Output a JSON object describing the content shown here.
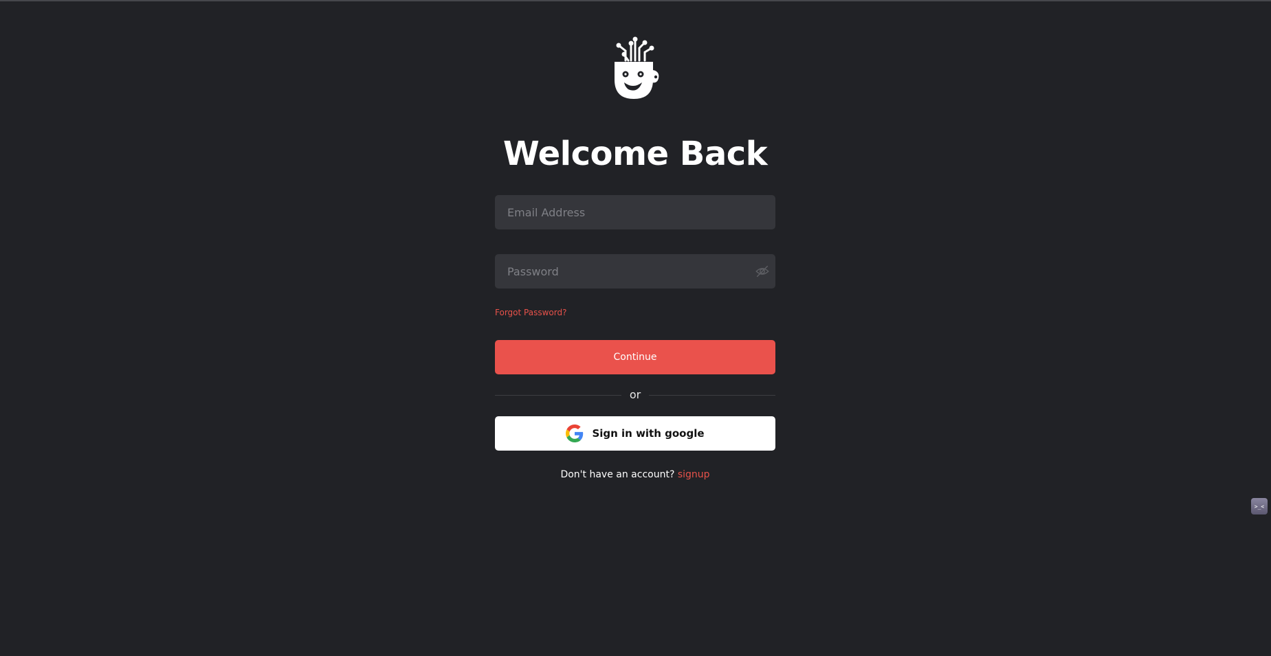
{
  "page": {
    "title": "Welcome Back"
  },
  "logo": {
    "icon": "brain-head-logo-icon"
  },
  "form": {
    "email": {
      "placeholder": "Email Address",
      "value": ""
    },
    "password": {
      "placeholder": "Password",
      "value": "",
      "toggle_icon": "eye-slash-icon"
    },
    "forgot_password_label": "Forgot Password?",
    "continue_label": "Continue",
    "divider_label": "or",
    "google_label": "Sign in with google",
    "google_icon": "google-icon"
  },
  "footer": {
    "prompt": "Don't have an account?",
    "signup_label": "signup"
  },
  "widget": {
    "label": ">_<",
    "icon": "assistant-widget-icon"
  },
  "colors": {
    "background": "#212226",
    "field": "#35363b",
    "accent": "#ea524c",
    "link": "#e8524a",
    "google_button": "#ffffff"
  }
}
